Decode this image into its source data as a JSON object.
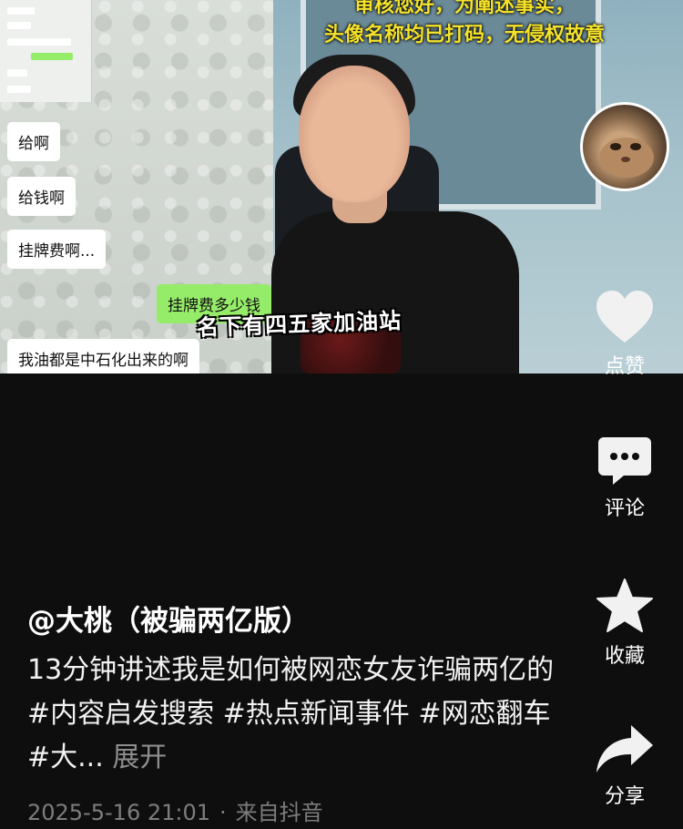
{
  "video": {
    "top_caption_lines": [
      "审核您好，为阐述事实，",
      "头像名称均已打码，无侵权故意"
    ],
    "subtitle": "名下有四五家加油站",
    "chat_bubbles": [
      {
        "text": "给啊",
        "side": "left"
      },
      {
        "text": "给钱啊",
        "side": "left"
      },
      {
        "text": "挂牌费啊...",
        "side": "left"
      },
      {
        "text": "挂牌费多少钱",
        "side": "right"
      },
      {
        "text": "我油都是中石化出来的啊",
        "side": "left"
      }
    ]
  },
  "rail": {
    "like_label": "点赞",
    "comment_label": "评论",
    "favorite_label": "收藏",
    "share_label": "分享"
  },
  "post": {
    "author": "@大桃（被骗两亿版）",
    "description": "13分钟讲述我是如何被网恋女友诈骗两亿的 #内容启发搜索 #热点新闻事件 #网恋翻车 #大...",
    "expand_label": "展开",
    "timestamp": "2025-5-16 21:01",
    "separator": "·",
    "source": "来自抖音"
  },
  "colors": {
    "background": "#0e0e0e",
    "caption_yellow": "#f5e22a",
    "wechat_green": "#95ec69"
  }
}
